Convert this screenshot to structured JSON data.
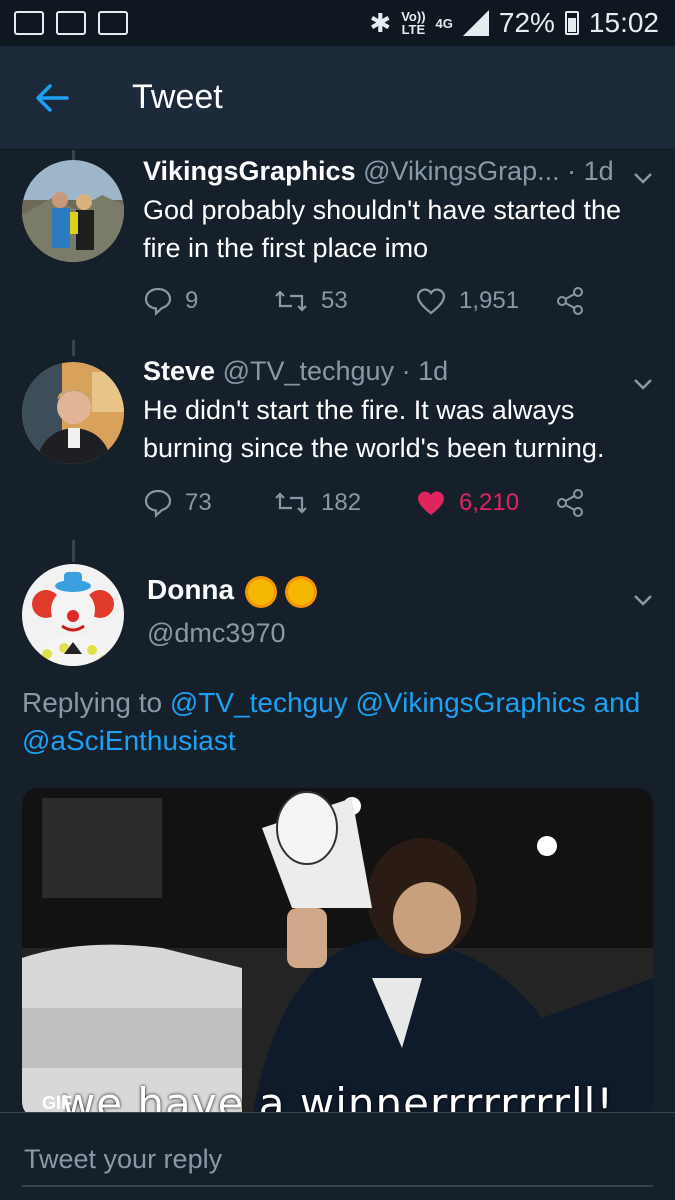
{
  "status_bar": {
    "volte": "Vo))",
    "lte": "LTE",
    "network": "4G",
    "battery": "72%",
    "time": "15:02"
  },
  "header": {
    "title": "Tweet"
  },
  "tweets": [
    {
      "name": "VikingsGraphics",
      "handle": "@VikingsGrap...",
      "time": "· 1d",
      "text": "God probably shouldn't have started the fire in the first place imo",
      "replies": "9",
      "retweets": "53",
      "likes": "1,951"
    },
    {
      "name": "Steve",
      "handle": "@TV_techguy",
      "time": "· 1d",
      "text": "He didn't start the fire. It was always burning since the world's been turning.",
      "replies": "73",
      "retweets": "182",
      "likes": "6,210"
    }
  ],
  "main_tweet": {
    "name": "Donna",
    "handle": "@dmc3970",
    "replying_prefix": "Replying to",
    "mention_1": "@TV_techguy",
    "mention_2": "@VikingsGraphics",
    "and": "and",
    "mention_3": "@aSciEnthusiast",
    "gif_badge": "GIF",
    "gif_caption": "we have a winnerrrrrrrrll!"
  },
  "reply": {
    "placeholder": "Tweet your reply"
  },
  "colors": {
    "accent": "#1da1f2",
    "like": "#e0245e",
    "background": "#15202b"
  }
}
